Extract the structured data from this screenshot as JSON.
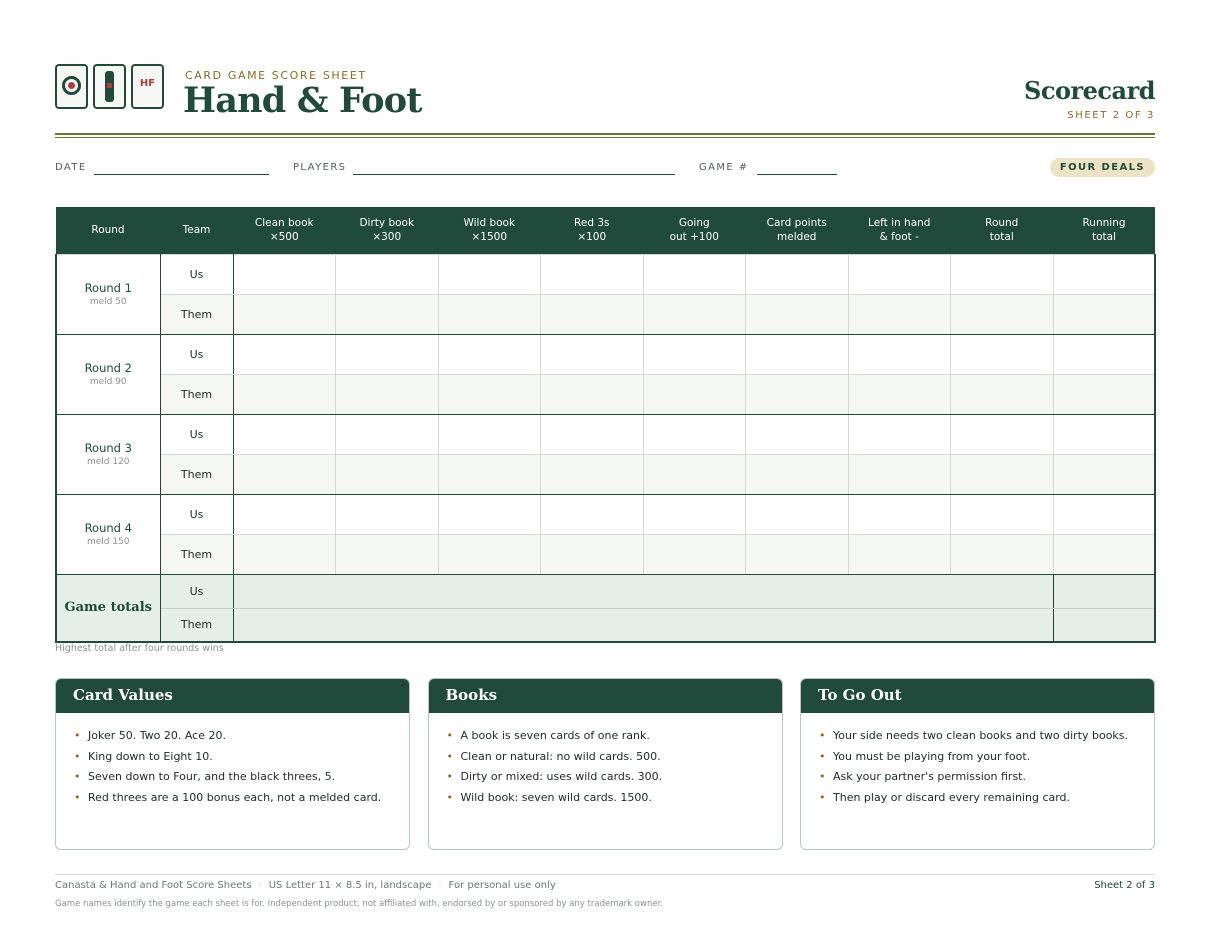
{
  "header": {
    "kicker": "CARD GAME SCORE SHEET",
    "title": "Hand & Foot",
    "right_title": "Scorecard",
    "sheet": "SHEET 2 OF 3",
    "logo_text": "HF"
  },
  "fields": {
    "date": "DATE",
    "players": "PLAYERS",
    "game": "GAME #",
    "badge": "FOUR DEALS"
  },
  "table": {
    "headers": [
      [
        "Round",
        ""
      ],
      [
        "Team",
        ""
      ],
      [
        "Clean book",
        "×500"
      ],
      [
        "Dirty book",
        "×300"
      ],
      [
        "Wild book",
        "×1500"
      ],
      [
        "Red 3s",
        "×100"
      ],
      [
        "Going",
        "out +100"
      ],
      [
        "Card points",
        "melded"
      ],
      [
        "Left in hand",
        "& foot  -"
      ],
      [
        "Round",
        "total"
      ],
      [
        "Running",
        "total"
      ]
    ],
    "teams": [
      "Us",
      "Them"
    ],
    "rounds": [
      {
        "name": "Round 1",
        "meld": "meld 50"
      },
      {
        "name": "Round 2",
        "meld": "meld 90"
      },
      {
        "name": "Round 3",
        "meld": "meld 120"
      },
      {
        "name": "Round 4",
        "meld": "meld 150"
      }
    ],
    "totals_label": "Game totals"
  },
  "note": "Highest total after four rounds wins",
  "boxes": [
    {
      "title": "Card Values",
      "items": [
        "Joker 50. Two 20. Ace 20.",
        "King down to Eight 10.",
        "Seven down to Four, and the black threes, 5.",
        "Red threes are a 100 bonus each, not a melded card."
      ]
    },
    {
      "title": "Books",
      "items": [
        "A book is seven cards of one rank.",
        "Clean or natural: no wild cards. 500.",
        "Dirty or mixed: uses wild cards. 300.",
        "Wild book: seven wild cards. 1500."
      ]
    },
    {
      "title": "To Go Out",
      "items": [
        "Your side needs two clean books and two dirty books.",
        "You must be playing from your foot.",
        "Ask your partner's permission first.",
        "Then play or discard every remaining card."
      ]
    }
  ],
  "footer": {
    "parts": [
      "Canasta & Hand and Foot Score Sheets",
      "US Letter 11 × 8.5 in, landscape",
      "For personal use only"
    ],
    "sheet": "Sheet 2 of 3",
    "fine": "Game names identify the game each sheet is for. Independent product, not affiliated with, endorsed by or sponsored by any trademark owner."
  },
  "colors": {
    "primary": "#1f4a3c",
    "accent_gold": "#8a6d1f",
    "accent_red": "#b33a3a",
    "badge_bg": "#ece3c4",
    "row_alt": "#f4f7f4",
    "totals_bg": "#e6eee9"
  }
}
